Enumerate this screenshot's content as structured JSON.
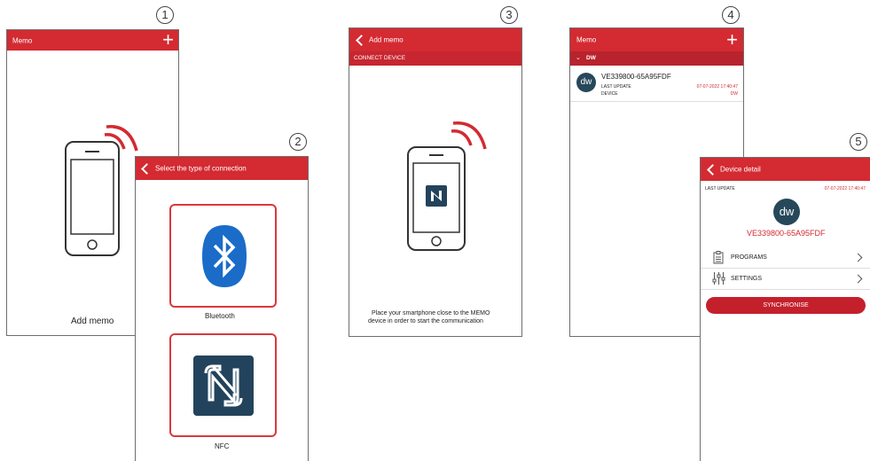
{
  "steps": [
    "1",
    "2",
    "3",
    "4",
    "5"
  ],
  "screen1": {
    "title": "Memo",
    "caption": "Add memo"
  },
  "screen2": {
    "title": "Select the type of connection",
    "bluetooth_label": "Bluetooth",
    "nfc_label": "NFC"
  },
  "screen3": {
    "title": "Add memo",
    "subheader": "CONNECT DEVICE",
    "instruction_line1": "Place your smartphone close to the MEMO",
    "instruction_line2": "device in order to start the communication"
  },
  "screen4": {
    "title": "Memo",
    "group": "DW",
    "device_name": "VE339800-65A95FDF",
    "avatar_text": "dw",
    "last_update_label": "LAST UPDATE",
    "last_update_value": "07-07-2022 17:40:47",
    "device_label": "DEVICE",
    "device_value": "DW"
  },
  "screen5": {
    "title": "Device detail",
    "last_update_label": "LAST UPDATE",
    "last_update_value": "07-07-2022 17:40:47",
    "avatar_text": "dw",
    "device_name": "VE339800-65A95FDF",
    "programs_label": "PROGRAMS",
    "settings_label": "SETTINGS",
    "sync_label": "SYNCHRONISE"
  },
  "colors": {
    "accent": "#d42a32",
    "avatar": "#26485a",
    "bluetooth": "#1a6cc8",
    "nfc": "#23435c"
  },
  "icons": [
    "plus-icon",
    "back-arrow-icon",
    "smartphone-icon",
    "signal-waves-icon",
    "bluetooth-icon",
    "nfc-icon",
    "chevron-right-icon",
    "clipboard-icon",
    "sliders-icon"
  ]
}
